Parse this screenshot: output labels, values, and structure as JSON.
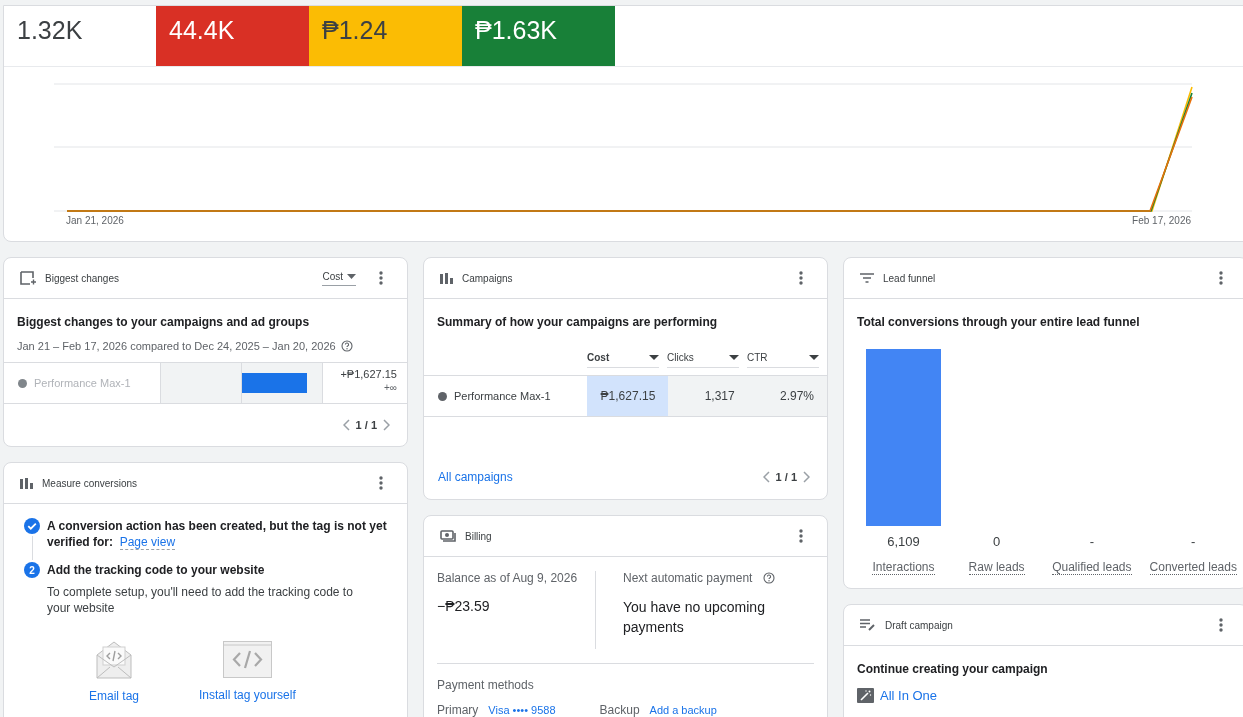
{
  "metrics": [
    {
      "value": "1.32K",
      "color": "#ffffff"
    },
    {
      "value": "44.4K",
      "color": "#d93025"
    },
    {
      "value": "₱1.24",
      "color": "#fbbc04"
    },
    {
      "value": "₱1.63K",
      "color": "#188038"
    }
  ],
  "trend_chart": {
    "x_labels": [
      "Jan 21, 2026",
      "Feb 17, 2026"
    ]
  },
  "biggest_changes": {
    "title": "Biggest changes",
    "metric_dropdown": "Cost",
    "heading": "Biggest changes to your campaigns and ad groups",
    "date_range": "Jan 21 – Feb 17, 2026 compared to Dec 24, 2025 – Jan 20, 2026",
    "rows": [
      {
        "name": "Performance Max-1",
        "disabled": true,
        "level": 0.81,
        "change": "+₱1,627.15",
        "percent": "+∞"
      }
    ],
    "page": "1 / 1"
  },
  "measure_conversions": {
    "title": "Measure conversions",
    "steps": [
      {
        "kind": "done",
        "text": "A conversion action has been created, but the tag is not yet verified for:",
        "link": "Page view"
      },
      {
        "kind": "numbered",
        "number": "2",
        "text": "Add the tracking code to your website",
        "description": "To complete setup, you'll need to add the tracking code to your website"
      }
    ],
    "options": [
      {
        "kind": "email",
        "label": "Email tag"
      },
      {
        "kind": "code",
        "label": "Install tag yourself"
      }
    ]
  },
  "campaigns": {
    "title": "Campaigns",
    "heading": "Summary of how your campaigns are performing",
    "columns": [
      {
        "label": "Cost",
        "selected": true
      },
      {
        "label": "Clicks",
        "selected": false
      },
      {
        "label": "CTR",
        "selected": false
      }
    ],
    "rows": [
      {
        "name": "Performance Max-1",
        "disabled": false,
        "cells": [
          "₱1,627.15",
          "1,317",
          "2.97%"
        ]
      }
    ],
    "link": "All campaigns",
    "page": "1 / 1"
  },
  "billing": {
    "title": "Billing",
    "balance_label": "Balance as of Aug 9, 2026",
    "balance": "−₱23.59",
    "next_payment_label": "Next automatic payment",
    "next_payment": "You have no upcoming payments",
    "payment_methods_label": "Payment methods",
    "primary_label": "Primary",
    "primary_card": "Visa •••• 9588",
    "backup_label": "Backup",
    "backup_link": "Add a backup"
  },
  "lead_funnel": {
    "title": "Lead funnel",
    "heading": "Total conversions through your entire lead funnel",
    "chart_data": {
      "type": "bar",
      "categories": [
        "Interactions",
        "Raw leads",
        "Qualified leads",
        "Converted leads"
      ],
      "values": [
        6109,
        0,
        null,
        null
      ],
      "ylim": [
        0,
        6109
      ],
      "value_labels": [
        "6,109",
        "0",
        "-",
        "-"
      ]
    }
  },
  "draft_campaign": {
    "title": "Draft campaign",
    "heading": "Continue creating your campaign",
    "campaign_link": "All In One"
  }
}
